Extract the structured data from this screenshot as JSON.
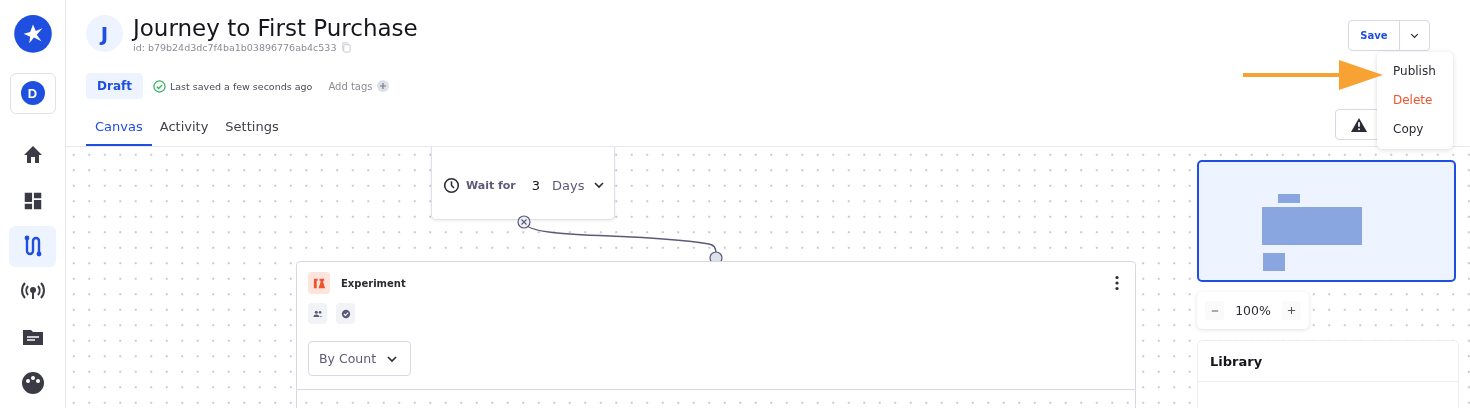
{
  "sidebar": {
    "workspace_initial": "D",
    "items": [
      {
        "kind": "home",
        "selected": false
      },
      {
        "kind": "dashboard",
        "selected": false
      },
      {
        "kind": "journey",
        "selected": true
      },
      {
        "kind": "broadcast",
        "selected": false
      },
      {
        "kind": "folder",
        "selected": false
      },
      {
        "kind": "palette",
        "selected": false
      }
    ]
  },
  "header": {
    "avatar_initial": "J",
    "title": "Journey to First Purchase",
    "id": "id: b79b24d3dc7f4ba1b03896776ab4c533",
    "status": "Draft",
    "saved": "Last saved a few seconds ago",
    "add_tags": "Add tags",
    "tabs": [
      {
        "label": "Canvas",
        "selected": true
      },
      {
        "label": "Activity",
        "selected": false
      },
      {
        "label": "Settings",
        "selected": false
      }
    ]
  },
  "actions": {
    "save": "Save",
    "menu": [
      {
        "label": "Publish",
        "kind": "normal"
      },
      {
        "label": "Delete",
        "kind": "danger"
      },
      {
        "label": "Copy",
        "kind": "normal"
      }
    ]
  },
  "canvas": {
    "wait_node": {
      "label": "Wait for",
      "value": "3",
      "unit": "Days"
    },
    "experiment_node": {
      "title": "Experiment",
      "split": "By Count"
    },
    "zoom": "100%",
    "library_title": "Library"
  }
}
